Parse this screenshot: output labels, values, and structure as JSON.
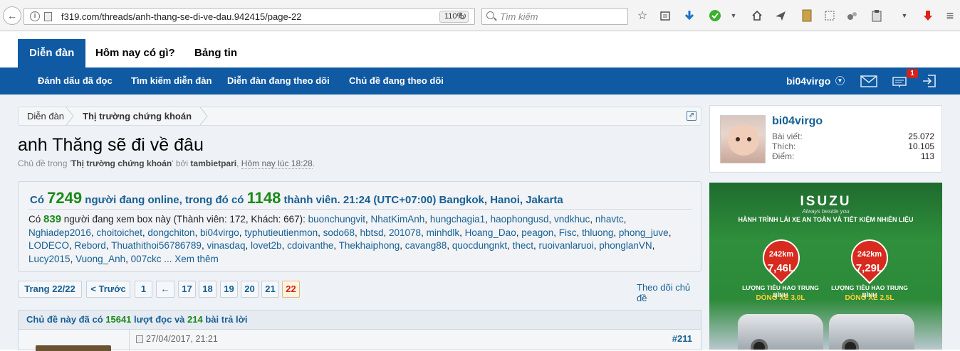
{
  "browser": {
    "url": "f319.com/threads/anh-thang-se-di-ve-dau.942415/page-22",
    "zoom": "110%",
    "search_placeholder": "Tìm kiếm"
  },
  "nav": {
    "tabs": [
      "Diễn đàn",
      "Hôm nay có gì?",
      "Bảng tin"
    ],
    "sub_items": [
      "Đánh dấu đã đọc",
      "Tìm kiếm diễn đàn",
      "Diễn đàn đang theo dõi",
      "Chủ đề đang theo dõi"
    ],
    "username": "bi04virgo",
    "alert_count": "1"
  },
  "breadcrumb": [
    "Diễn đàn",
    "Thị trường chứng khoán"
  ],
  "thread": {
    "title": "anh Thăng sẽ đi về đâu",
    "meta_prefix": "Chủ đề trong '",
    "forum": "Thị trường chứng khoán",
    "meta_by": "' bởi ",
    "author": "tambietpari",
    "meta_sep": ", ",
    "time": "Hôm nay lúc 18:28",
    "meta_end": "."
  },
  "online": {
    "h_pre": "Có ",
    "total": "7249",
    "h_mid": " người đang online, trong đó có ",
    "members": "1148",
    "h_post": " thành viên. 21:24 (UTC+07:00) Bangkok, Hanoi, Jakarta",
    "v_pre": "Có ",
    "viewing": "839",
    "v_post": " người đang xem box này (Thành viên: 172, Khách: 667): ",
    "users": [
      "buonchungvit",
      "NhatKimAnh",
      "hungchagia1",
      "haophongusd",
      "vndkhuc",
      "nhavtc",
      "Nghiadep2016",
      "choitoichet",
      "dongchiton",
      "bi04virgo",
      "typhutieutienmon",
      "sodo68",
      "hbtsd",
      "201078",
      "minhdlk",
      "Hoang_Dao",
      "peagon",
      "Fisc",
      "thluong",
      "phong_juve",
      "LODECO",
      "Rebord",
      "Thuathithoi56786789",
      "vinasdaq",
      "lovet2b",
      "cdoivanthe",
      "Thekhaiphong",
      "cavang88",
      "quocdungnkt",
      "thect",
      "ruoivanlaruoi",
      "phonglanVN",
      "Lucy2015",
      "Vuong_Anh",
      "007ckc"
    ],
    "more": " ... Xem thêm"
  },
  "pager": {
    "label": "Trang 22/22",
    "prev": "< Trước",
    "pages": [
      "1",
      "←",
      "17",
      "18",
      "19",
      "20",
      "21",
      "22"
    ],
    "current": "22",
    "watch": "Theo dõi chủ đề"
  },
  "readbar": {
    "pre": "Chủ đề này đã có ",
    "views": "15641",
    "mid": " lượt đọc và ",
    "replies": "214",
    "post": " bài trả lời"
  },
  "post": {
    "date": "27/04/2017, 21:21",
    "number": "#211"
  },
  "userbox": {
    "name": "bi04virgo",
    "stats": [
      {
        "label": "Bài viết:",
        "value": "25.072"
      },
      {
        "label": "Thích:",
        "value": "10.105"
      },
      {
        "label": "Điểm:",
        "value": "113"
      }
    ]
  },
  "ad": {
    "brand": "ISUZU",
    "tagline": "Always beside you",
    "slogan": "HÀNH TRÌNH LÁI XE AN TOÀN VÀ TIẾT KIỆM NHIÊN LIỆU",
    "left": {
      "km": "242km",
      "fuel": "7,46L",
      "cap1": "LƯỢNG TIÊU HAO TRUNG BÌNH",
      "cap2": "DÒNG XE 3,0L"
    },
    "right": {
      "km": "242km",
      "fuel": "7,29L",
      "cap1": "LƯỢNG TIÊU HAO TRUNG BÌNH",
      "cap2": "DÒNG XE 2,5L"
    }
  },
  "colors": {
    "brand_blue": "#0f5aa3",
    "link": "#176093",
    "green": "#1a8a1a",
    "current_page": "#d2231b"
  }
}
